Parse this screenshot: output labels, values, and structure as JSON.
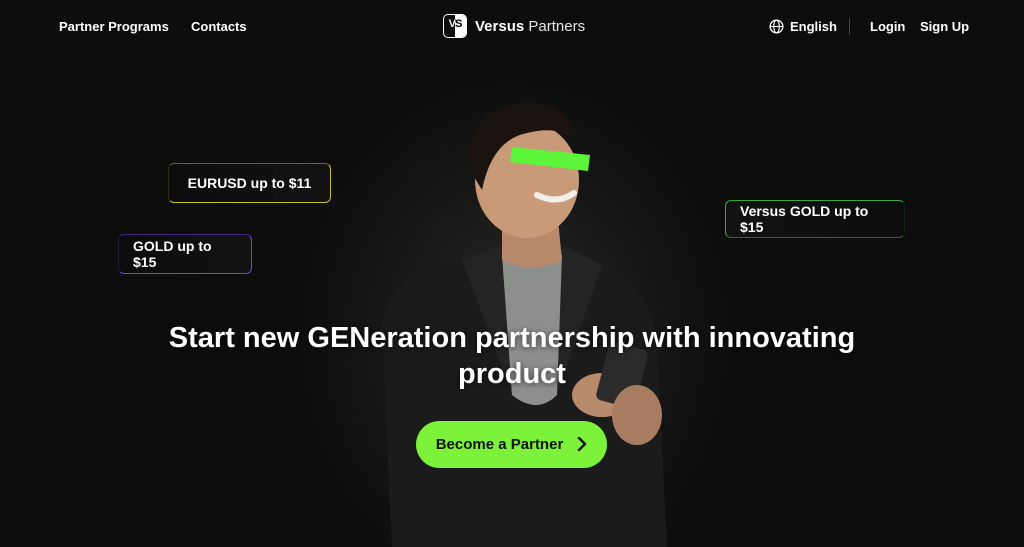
{
  "nav": {
    "partner_programs": "Partner Programs",
    "contacts": "Contacts",
    "logo_mark": "VS",
    "logo_brand": "Versus",
    "logo_suffix": "Partners",
    "language": "English",
    "login": "Login",
    "signup": "Sign Up"
  },
  "badges": {
    "eurusd": "EURUSD up to $11",
    "gold": "GOLD up to $15",
    "versus_gold": "Versus GOLD up to $15"
  },
  "hero": {
    "headline_line1": "Start new GENeration partnership with innovating",
    "headline_line2": "product",
    "cta": "Become a Partner"
  },
  "colors": {
    "background": "#0d0d0d",
    "accent": "#7cf23b",
    "eurusd_border": "#c9bf2b",
    "gold_border": "#7a3cf0",
    "versus_border": "#3aa83a"
  },
  "icons": [
    "globe-icon",
    "chevron-right-icon"
  ]
}
